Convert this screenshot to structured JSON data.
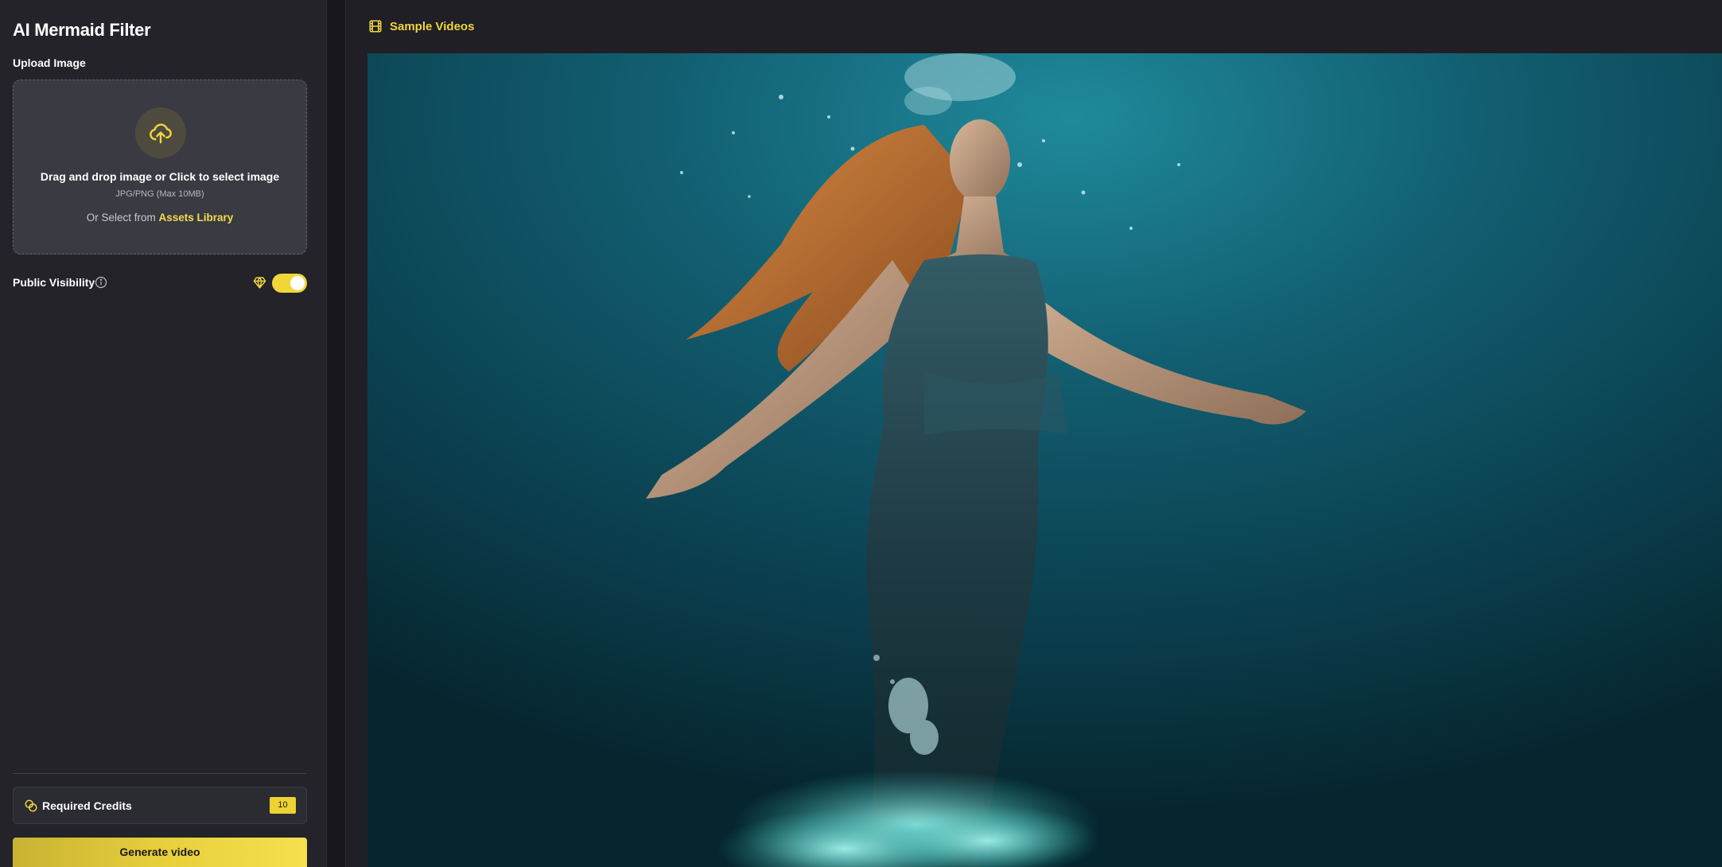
{
  "sidebar": {
    "title": "AI Mermaid Filter",
    "upload_label": "Upload Image",
    "dropzone": {
      "main_text": "Drag and drop image or Click to select image",
      "sub_text": "JPG/PNG (Max 10MB)",
      "alt_prefix": "Or Select from",
      "alt_link": "Assets Library"
    },
    "visibility": {
      "label": "Public Visibility",
      "enabled": true
    },
    "credits": {
      "label": "Required Credits",
      "value": "10"
    },
    "generate_label": "Generate video"
  },
  "main": {
    "header_title": "Sample Videos",
    "video": {
      "description_icon": "mermaid-underwater-video"
    }
  },
  "colors": {
    "accent": "#f0d63e",
    "sidebar_bg": "#232329",
    "main_bg": "#1f1f25",
    "dropzone_bg": "#3a3a43"
  }
}
